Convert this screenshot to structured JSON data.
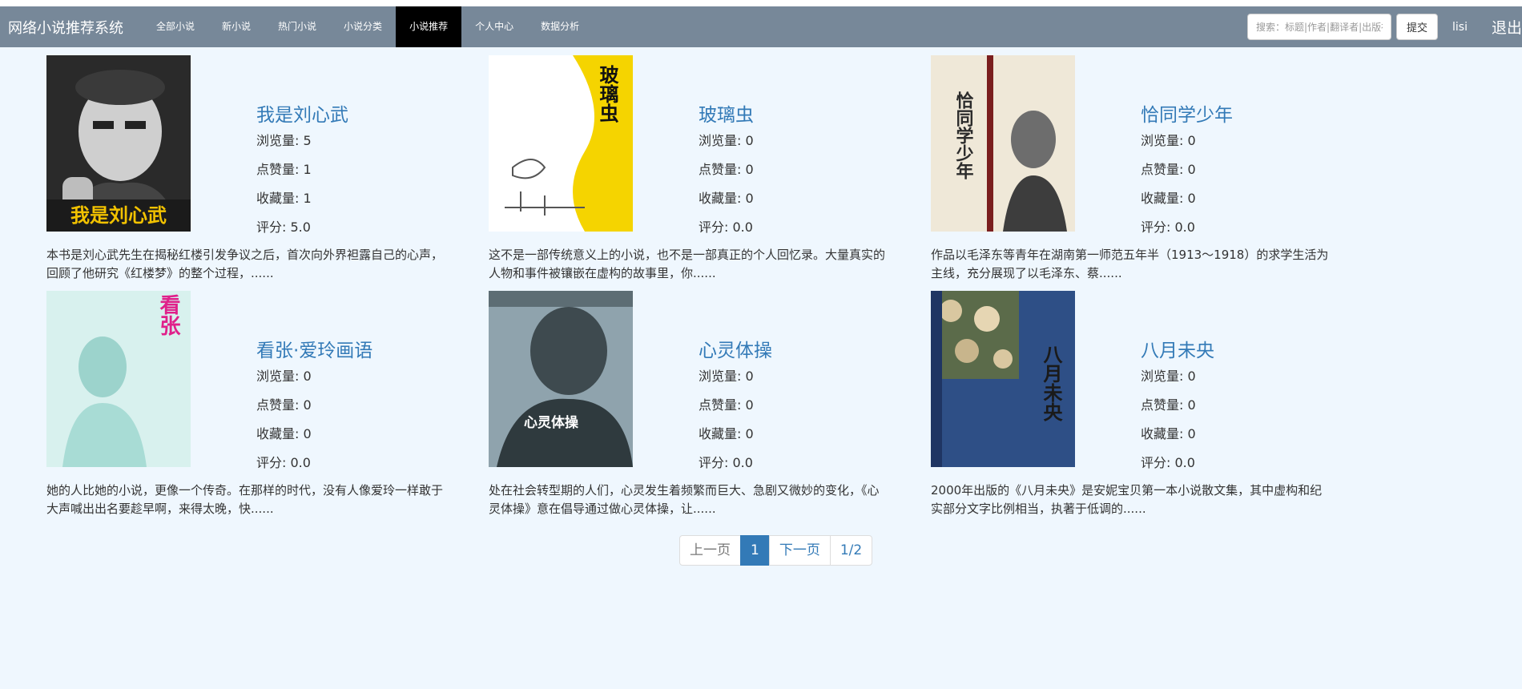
{
  "navbar": {
    "brand": "网络小说推荐系统",
    "items": [
      {
        "label": "全部小说"
      },
      {
        "label": "新小说"
      },
      {
        "label": "热门小说"
      },
      {
        "label": "小说分类"
      },
      {
        "label": "小说推荐"
      },
      {
        "label": "个人中心"
      },
      {
        "label": "数据分析"
      }
    ],
    "active_item": "小说推荐",
    "search": {
      "placeholder": "搜索：标题|作者|翻译者|出版社",
      "value": ""
    },
    "submit_label": "提交",
    "user": "lisi",
    "logout_label": "退出"
  },
  "books": [
    {
      "title": "我是刘心武",
      "stats": [
        {
          "label": "浏览量:",
          "value": "5"
        },
        {
          "label": "点赞量:",
          "value": "1"
        },
        {
          "label": "收藏量:",
          "value": "1"
        },
        {
          "label": "评分:",
          "value": "5.0"
        }
      ],
      "desc": "本书是刘心武先生在揭秘红楼引发争议之后，首次向外界袒露自己的心声，回顾了他研究《红楼梦》的整个过程，......",
      "cover_text": "我是刘心武"
    },
    {
      "title": "玻璃虫",
      "stats": [
        {
          "label": "浏览量:",
          "value": "0"
        },
        {
          "label": "点赞量:",
          "value": "0"
        },
        {
          "label": "收藏量:",
          "value": "0"
        },
        {
          "label": "评分:",
          "value": "0.0"
        }
      ],
      "desc": "这不是一部传统意义上的小说，也不是一部真正的个人回忆录。大量真实的人物和事件被镶嵌在虚构的故事里，你......",
      "cover_text": "玻璃虫"
    },
    {
      "title": "恰同学少年",
      "stats": [
        {
          "label": "浏览量:",
          "value": "0"
        },
        {
          "label": "点赞量:",
          "value": "0"
        },
        {
          "label": "收藏量:",
          "value": "0"
        },
        {
          "label": "评分:",
          "value": "0.0"
        }
      ],
      "desc": "作品以毛泽东等青年在湖南第一师范五年半（1913～1918）的求学生活为主线，充分展现了以毛泽东、蔡......",
      "cover_text": "恰同学少年"
    },
    {
      "title": "看张·爱玲画语",
      "stats": [
        {
          "label": "浏览量:",
          "value": "0"
        },
        {
          "label": "点赞量:",
          "value": "0"
        },
        {
          "label": "收藏量:",
          "value": "0"
        },
        {
          "label": "评分:",
          "value": "0.0"
        }
      ],
      "desc": "她的人比她的小说，更像一个传奇。在那样的时代，没有人像爱玲一样敢于大声喊出出名要趁早啊，来得太晚，快......",
      "cover_text": "看张"
    },
    {
      "title": "心灵体操",
      "stats": [
        {
          "label": "浏览量:",
          "value": "0"
        },
        {
          "label": "点赞量:",
          "value": "0"
        },
        {
          "label": "收藏量:",
          "value": "0"
        },
        {
          "label": "评分:",
          "value": "0.0"
        }
      ],
      "desc": "处在社会转型期的人们，心灵发生着频繁而巨大、急剧又微妙的变化，《心灵体操》意在倡导通过做心灵体操，让......",
      "cover_text": "心灵体操"
    },
    {
      "title": "八月未央",
      "stats": [
        {
          "label": "浏览量:",
          "value": "0"
        },
        {
          "label": "点赞量:",
          "value": "0"
        },
        {
          "label": "收藏量:",
          "value": "0"
        },
        {
          "label": "评分:",
          "value": "0.0"
        }
      ],
      "desc": "2000年出版的《八月未央》是安妮宝贝第一本小说散文集，其中虚构和纪实部分文字比例相当，执著于低调的......",
      "cover_text": "八月未央"
    }
  ],
  "pagination": {
    "prev_label": "上一页",
    "current": "1",
    "next_label": "下一页",
    "summary": "1/2"
  }
}
